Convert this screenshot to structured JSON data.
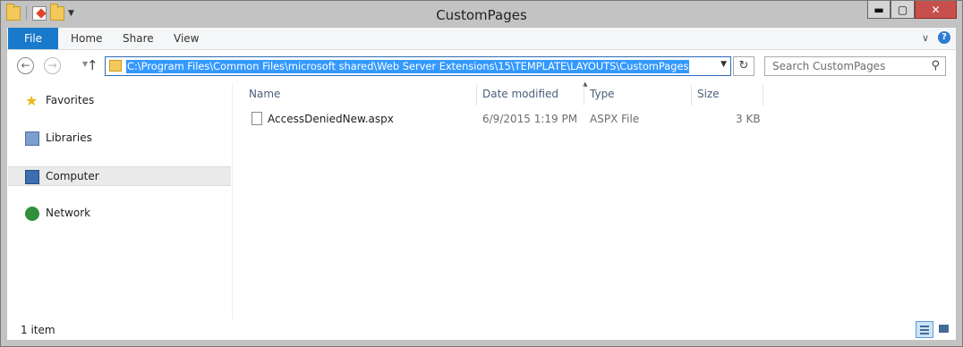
{
  "window": {
    "title": "CustomPages"
  },
  "title_buttons": {
    "minimize": "▬",
    "maximize": "▢",
    "close": "✕"
  },
  "ribbon": {
    "tabs": [
      "File",
      "Home",
      "Share",
      "View"
    ]
  },
  "navbar": {
    "address": "C:\\Program Files\\Common Files\\microsoft shared\\Web Server Extensions\\15\\TEMPLATE\\LAYOUTS\\CustomPages",
    "search_placeholder": "Search CustomPages"
  },
  "nav_pane": {
    "items": [
      {
        "label": "Favorites",
        "icon": "star-icon"
      },
      {
        "label": "Libraries",
        "icon": "libraries-icon"
      },
      {
        "label": "Computer",
        "icon": "computer-icon",
        "selected": true
      },
      {
        "label": "Network",
        "icon": "network-icon"
      }
    ]
  },
  "file_list": {
    "columns": [
      "Name",
      "Date modified",
      "Type",
      "Size"
    ],
    "rows": [
      {
        "name": "AccessDeniedNew.aspx",
        "date_modified": "6/9/2015 1:19 PM",
        "type": "ASPX File",
        "size": "3 KB"
      }
    ]
  },
  "status": {
    "count": "1 item"
  },
  "colors": {
    "file_tab": "#1979ca",
    "selection": "#3399ff",
    "chrome": "#c3c3c3"
  }
}
